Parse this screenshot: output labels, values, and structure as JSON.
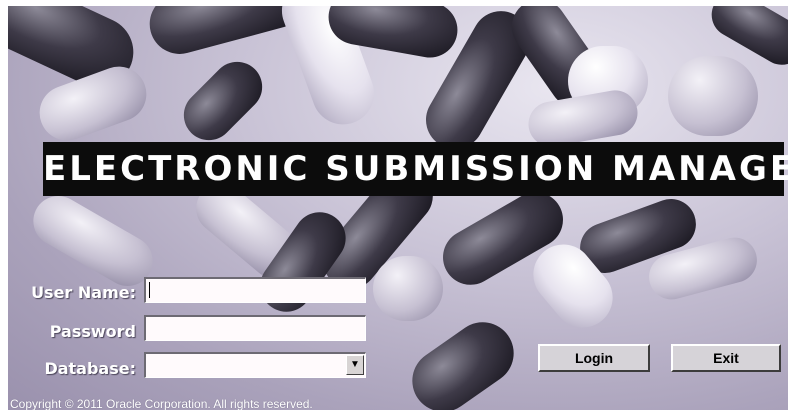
{
  "app": {
    "title": "ELECTRONIC SUBMISSION MANAGER"
  },
  "login_form": {
    "username_label": "User Name:",
    "username_value": "",
    "password_label": "Password",
    "password_value": "",
    "database_label": "Database:",
    "database_value": ""
  },
  "buttons": {
    "login": "Login",
    "exit": "Exit"
  },
  "footer": {
    "copyright": "Copyright © 2011 Oracle Corporation. All rights reserved."
  },
  "icons": {
    "dropdown": "chevron-down-icon"
  }
}
